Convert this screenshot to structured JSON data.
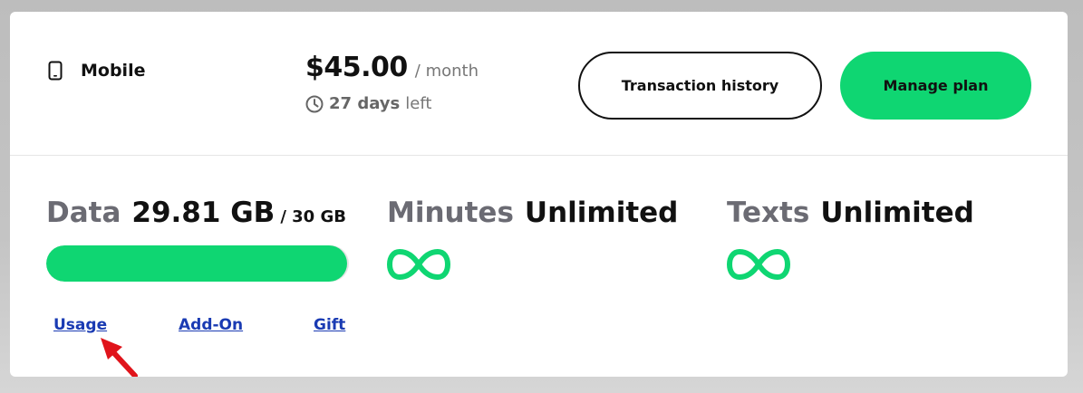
{
  "plan": {
    "name": "Mobile",
    "icon": "phone-icon",
    "price": "$45.00",
    "period": "/ month",
    "days_count": "27 days",
    "days_suffix": "left",
    "clock_icon": "clock-icon"
  },
  "buttons": {
    "transaction_history": "Transaction history",
    "manage_plan": "Manage plan"
  },
  "usage": {
    "data": {
      "label": "Data",
      "used": "29.81 GB",
      "cap": "/ 30 GB",
      "progress_fraction": 0.994
    },
    "minutes": {
      "label": "Minutes",
      "value": "Unlimited",
      "icon": "infinity-icon"
    },
    "texts": {
      "label": "Texts",
      "value": "Unlimited",
      "icon": "infinity-icon"
    }
  },
  "links": {
    "usage": "Usage",
    "addon": "Add-On",
    "gift": "Gift"
  },
  "colors": {
    "accent_green": "#0fd672",
    "link_blue": "#1a3bb3",
    "annotation_red": "#e0141b"
  }
}
